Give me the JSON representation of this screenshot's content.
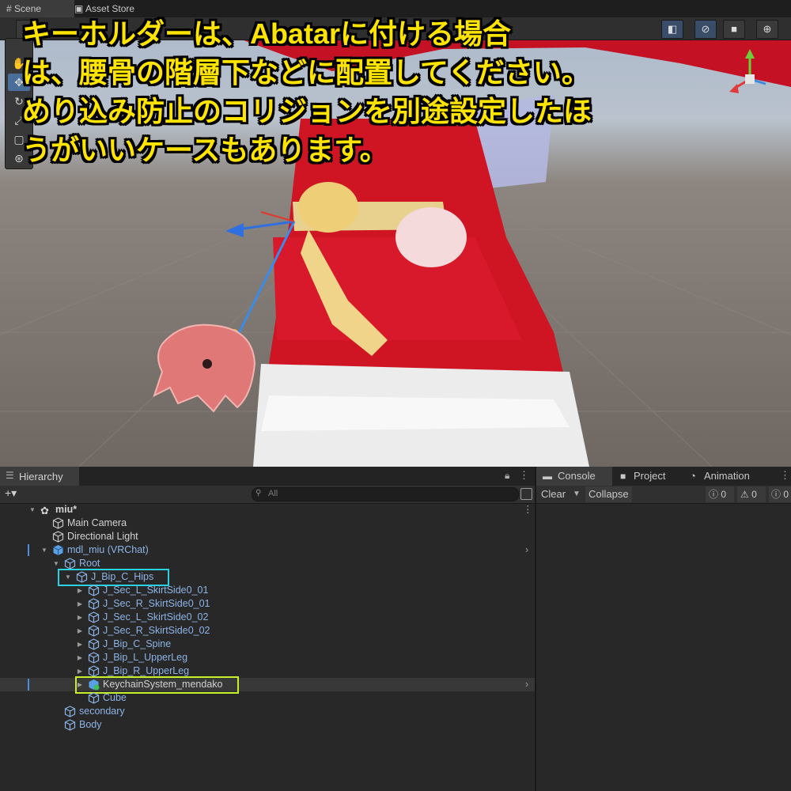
{
  "scene": {
    "tabs": [
      "Scene",
      "Asset Store"
    ],
    "caption_lines": [
      "キーホルダーは、Abatarに付ける場合",
      "は、腰骨の階層下などに配置してください。",
      "めり込み防止のコリジョンを別途設定したほ",
      "うがいいケースもあります。"
    ]
  },
  "hierarchy": {
    "tab_label": "Hierarchy",
    "add_label": "+▾",
    "search_placeholder": "All",
    "rows": [
      {
        "label": "miu*"
      },
      {
        "label": "Main Camera"
      },
      {
        "label": "Directional Light"
      },
      {
        "label": "mdl_miu (VRChat)"
      },
      {
        "label": "Root"
      },
      {
        "label": "J_Bip_C_Hips"
      },
      {
        "label": "J_Sec_L_SkirtSide0_01"
      },
      {
        "label": "J_Sec_R_SkirtSide0_01"
      },
      {
        "label": "J_Sec_L_SkirtSide0_02"
      },
      {
        "label": "J_Sec_R_SkirtSide0_02"
      },
      {
        "label": "J_Bip_C_Spine"
      },
      {
        "label": "J_Bip_L_UpperLeg"
      },
      {
        "label": "J_Bip_R_UpperLeg"
      },
      {
        "label": "KeychainSystem_mendako"
      },
      {
        "label": "Cube"
      },
      {
        "label": "secondary"
      },
      {
        "label": "Body"
      }
    ]
  },
  "console": {
    "tabs": {
      "console": "Console",
      "project": "Project",
      "animation": "Animation"
    },
    "clear_label": "Clear",
    "collapse_label": "Collapse",
    "counts": {
      "info": "0",
      "warnings": "0",
      "errors": "0"
    }
  },
  "colors": {
    "caption": "#ffe400",
    "highlight_hips": "#2ad1e0",
    "highlight_keychain": "#c8f02a"
  }
}
